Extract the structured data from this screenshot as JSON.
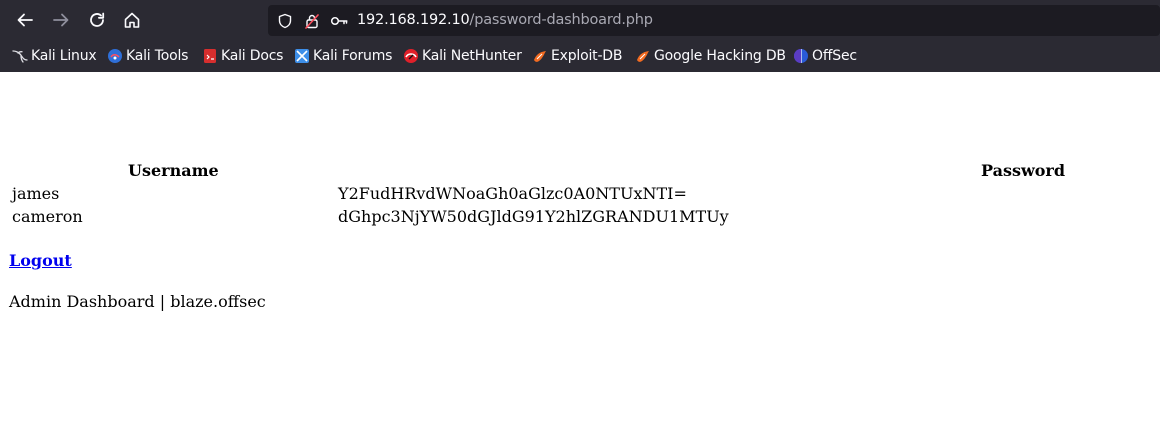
{
  "browser": {
    "url_host": "192.168.192.10",
    "url_path": "/password-dashboard.php",
    "bookmarks": [
      {
        "label": "Kali Linux",
        "icon": "kali-dragon-icon"
      },
      {
        "label": "Kali Tools",
        "icon": "kali-tools-icon"
      },
      {
        "label": "Kali Docs",
        "icon": "kali-docs-icon"
      },
      {
        "label": "Kali Forums",
        "icon": "kali-forums-icon"
      },
      {
        "label": "Kali NetHunter",
        "icon": "kali-nethunter-icon"
      },
      {
        "label": "Exploit-DB",
        "icon": "exploit-db-icon"
      },
      {
        "label": "Google Hacking DB",
        "icon": "google-hacking-db-icon"
      },
      {
        "label": "OffSec",
        "icon": "offsec-icon"
      }
    ],
    "colors": {
      "chrome_bg": "#2b2a33",
      "urlbar_bg": "#1c1b22",
      "text": "#fbfbfe"
    }
  },
  "table": {
    "headers": {
      "username": "Username",
      "password": "Password"
    },
    "rows": [
      {
        "username": "james",
        "password": "Y2FudHRvdWNoaGh0aGlzc0A0NTUxNTI="
      },
      {
        "username": "cameron",
        "password": "dGhpc3NjYW50dGJldG91Y2hlZGRANDU1MTUy"
      }
    ]
  },
  "logout_label": "Logout",
  "footer_text": "Admin Dashboard | blaze.offsec",
  "colors": {
    "link": "#0000ee",
    "page_bg": "#ffffff"
  }
}
